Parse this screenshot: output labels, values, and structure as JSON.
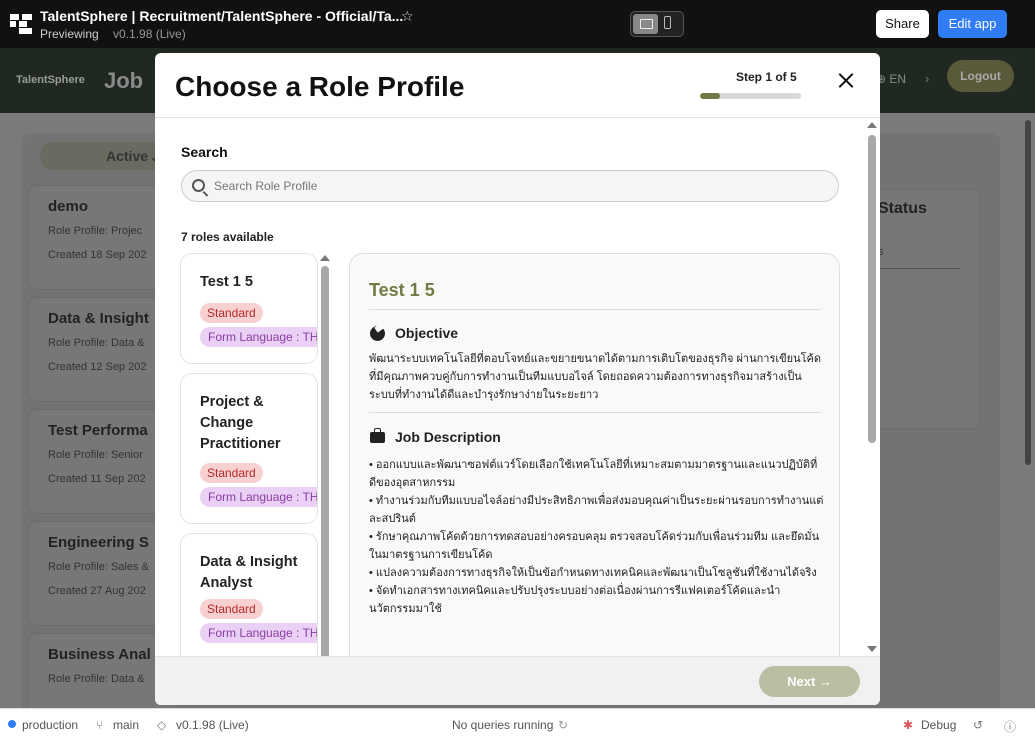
{
  "topbar": {
    "title": "TalentSphere | Recruitment/TalentSphere - Official/Ta...",
    "previewing": "Previewing",
    "version": "v0.1.98 (Live)",
    "share": "Share",
    "edit_app": "Edit app"
  },
  "app": {
    "logo": "TalentSphere",
    "heading": "Job",
    "lang": "EN",
    "logout": "Logout",
    "active_tab": "Active J",
    "status_title": "Status",
    "status_text": "s",
    "cards": [
      {
        "title": "demo",
        "role": "Role Profile: Projec",
        "created": "Created 18 Sep 202"
      },
      {
        "title": "Data & Insight",
        "role": "Role Profile: Data &",
        "created": "Created 12 Sep 202"
      },
      {
        "title": "Test Performa",
        "role": "Role Profile: Senior",
        "created": "Created 11 Sep 202"
      },
      {
        "title": "Engineering S",
        "role": "Role Profile: Sales &",
        "created": "Created 27 Aug 202"
      },
      {
        "title": "Business Anal",
        "role": "Role Profile: Data &",
        "created": ""
      }
    ]
  },
  "modal": {
    "title": "Choose a Role Profile",
    "step_label": "Step 1 of 5",
    "step_progress": 0.2,
    "search_label": "Search",
    "search_placeholder": "Search Role Profile",
    "roles_count": "7 roles available",
    "roles": [
      {
        "name": "Test 1 5",
        "tag": "Standard",
        "lang": "Form Language : TH"
      },
      {
        "name": "Project & Change Practitioner",
        "tag": "Standard",
        "lang": "Form Language : TH"
      },
      {
        "name": "Data & Insight Analyst",
        "tag": "Standard",
        "lang": "Form Language : TH"
      }
    ],
    "detail": {
      "title": "Test 1 5",
      "objective_heading": "Objective",
      "objective_text": "พัฒนาระบบเทคโนโลยีที่ตอบโจทย์และขยายขนาดได้ตามการเติบโตของธุรกิจ ผ่านการเขียนโค้ดที่มีคุณภาพควบคู่กับการทำงานเป็นทีมแบบอไจล์ โดยถอดความต้องการทางธุรกิจมาสร้างเป็นระบบที่ทำงานได้ดีและบำรุงรักษาง่ายในระยะยาว",
      "jd_heading": "Job Description",
      "jd_items": [
        "• ออกแบบและพัฒนาซอฟต์แวร์โดยเลือกใช้เทคโนโลยีที่เหมาะสมตามมาตรฐานและแนวปฏิบัติที่ดีของอุตสาหกรรม",
        "• ทำงานร่วมกับทีมแบบอไจล์อย่างมีประสิทธิภาพเพื่อส่งมอบคุณค่าเป็นระยะผ่านรอบการทำงานแต่ละสปรินต์",
        "• รักษาคุณภาพโค้ดด้วยการทดสอบอย่างครอบคลุม ตรวจสอบโค้ดร่วมกับเพื่อนร่วมทีม และยึดมั่นในมาตรฐานการเขียนโค้ด",
        "• แปลงความต้องการทางธุรกิจให้เป็นข้อกำหนดทางเทคนิคและพัฒนาเป็นโซลูชันที่ใช้งานได้จริง",
        "• จัดทำเอกสารทางเทคนิคและปรับปรุงระบบอย่างต่อเนื่องผ่านการรีแฟคเตอร์โค้ดและนำนวัตกรรมมาใช้"
      ]
    },
    "next": "Next →"
  },
  "bottombar": {
    "env": "production",
    "branch": "main",
    "version": "v0.1.98 (Live)",
    "queries": "No queries running",
    "debug": "Debug"
  },
  "colors": {
    "accent": "#6f7a45",
    "primary_button": "#2f7cf6"
  }
}
